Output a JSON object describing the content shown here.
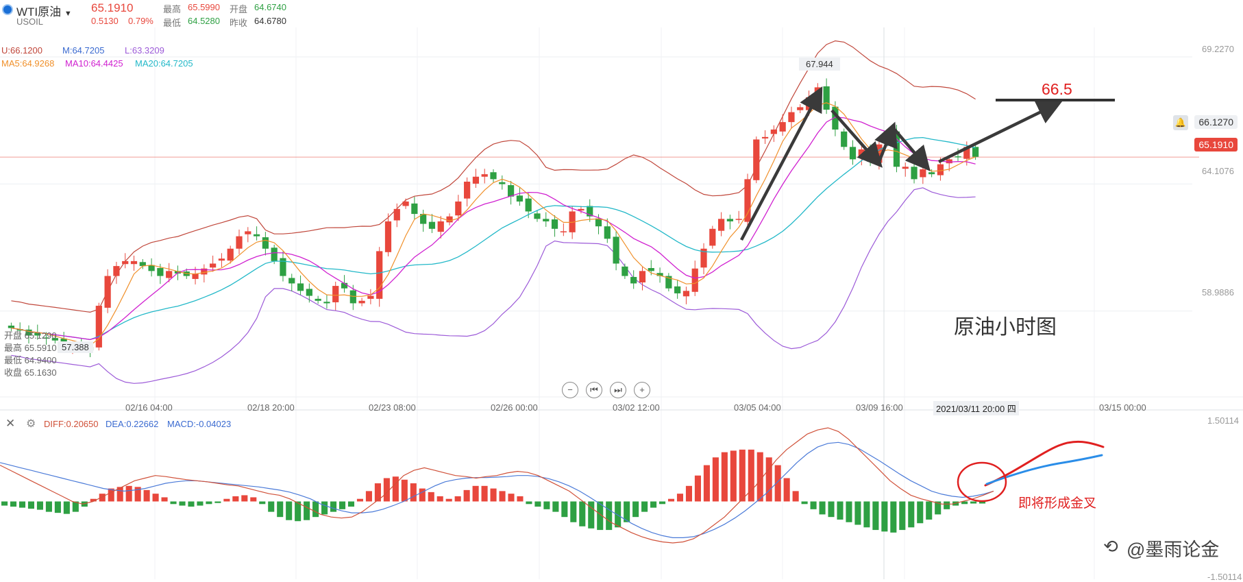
{
  "header": {
    "symbol_name": "WTI原油",
    "symbol_code": "USOIL",
    "price": "65.1910",
    "change": "0.5130",
    "change_pct": "0.79%",
    "high_label": "最高",
    "high": "65.5990",
    "open_label": "开盘",
    "open": "64.6740",
    "low_label": "最低",
    "low": "64.5280",
    "prev_close_label": "昨收",
    "prev_close": "64.6780"
  },
  "indicators": {
    "boll": {
      "u": "U:66.1200",
      "m": "M:64.7205",
      "l": "L:63.3209"
    },
    "ma": {
      "ma5": "MA5:64.9268",
      "ma10": "MA10:64.4425",
      "ma20": "MA20:64.7205"
    },
    "macd": {
      "diff": "DIFF:0.20650",
      "dea": "DEA:0.22662",
      "macd": "MACD:-0.04023"
    }
  },
  "ohlc_panel": {
    "open": "开盘 65.1290",
    "high": "最高 65.5910",
    "low": "最低 64.9400",
    "close": "收盘 65.1630"
  },
  "annotations": {
    "chart_title": "原油小时图",
    "target": "66.5",
    "peak": "67.944",
    "trough": "57.388",
    "golden_cross": "即将形成金叉",
    "watermark": "@墨雨论金",
    "cursor_time": "2021/03/11 20:00 四"
  },
  "price_axis": [
    "69.2270",
    "64.1076",
    "58.9886"
  ],
  "macd_axis": [
    "1.50114",
    "-1.50114"
  ],
  "price_tags": {
    "alert": "66.1270",
    "current": "65.1910"
  },
  "time_axis": [
    "02/16 04:00",
    "02/18 20:00",
    "02/23 08:00",
    "02/26 00:00",
    "03/02 12:00",
    "03/05 04:00",
    "03/09 16:00",
    "03/15 00:00"
  ],
  "colors": {
    "up": "#e8473c",
    "down": "#2ea043",
    "ma5": "#f0902a",
    "ma10": "#d020d0",
    "ma20": "#22b8c8",
    "boll_upper": "#c0463a",
    "boll_lower": "#9c5ad8",
    "diff": "#d05038",
    "dea": "#4a7ad8"
  },
  "chart_data": [
    {
      "type": "candlestick",
      "title": "",
      "y_ticks": [
        58.9886,
        64.1076,
        69.227
      ],
      "ylim": [
        55.5,
        70.0
      ],
      "x_ticks": [
        "02/16 04:00",
        "02/18 20:00",
        "02/23 08:00",
        "02/26 00:00",
        "03/02 12:00",
        "03/05 04:00",
        "03/09 16:00",
        "03/15 00:00"
      ],
      "closes": [
        58.3,
        58.2,
        58.0,
        58.0,
        57.9,
        57.8,
        57.7,
        57.6,
        57.5,
        57.4,
        59.2,
        60.4,
        60.8,
        61.0,
        61.0,
        60.8,
        60.6,
        60.4,
        60.6,
        60.5,
        60.4,
        60.5,
        60.7,
        60.9,
        61.1,
        61.5,
        62.0,
        62.2,
        62.0,
        61.5,
        61.0,
        60.4,
        60.1,
        59.8,
        59.6,
        59.4,
        59.3,
        60.0,
        59.9,
        59.3,
        59.4,
        59.6,
        61.4,
        62.6,
        63.1,
        63.4,
        62.9,
        62.5,
        62.3,
        62.6,
        62.8,
        63.4,
        64.2,
        64.4,
        64.5,
        64.3,
        64.1,
        63.6,
        63.4,
        63.0,
        62.7,
        62.6,
        62.3,
        62.2,
        63.0,
        63.1,
        62.8,
        62.4,
        61.9,
        60.9,
        60.4,
        60.1,
        60.6,
        60.6,
        60.4,
        59.9,
        59.7,
        59.8,
        60.7,
        61.5,
        62.3,
        62.7,
        62.6,
        62.7,
        64.3,
        65.9,
        66.0,
        66.3,
        66.6,
        67.0,
        67.2,
        67.6,
        68.0,
        67.1,
        66.3,
        65.6,
        65.1,
        65.5,
        65.0,
        65.7,
        66.1,
        64.8,
        64.8,
        64.3,
        64.7,
        64.5,
        64.9,
        65.1,
        65.2,
        65.6,
        65.2
      ],
      "open_labels": "plotted as OHLC bars; high and low approximate",
      "series": [
        {
          "name": "MA5"
        },
        {
          "name": "MA10"
        },
        {
          "name": "MA20"
        },
        {
          "name": "BOLL U"
        },
        {
          "name": "BOLL L"
        }
      ]
    },
    {
      "type": "bar",
      "title": "",
      "ylim": [
        -1.50114,
        1.50114
      ],
      "hist": [
        -0.08,
        -0.1,
        -0.12,
        -0.14,
        -0.16,
        -0.2,
        -0.22,
        -0.24,
        -0.2,
        -0.1,
        0.05,
        0.15,
        0.25,
        0.28,
        0.3,
        0.28,
        0.22,
        0.15,
        0.08,
        -0.05,
        -0.08,
        -0.1,
        -0.08,
        -0.05,
        -0.03,
        0.05,
        0.1,
        0.12,
        0.08,
        -0.05,
        -0.2,
        -0.3,
        -0.36,
        -0.38,
        -0.36,
        -0.3,
        -0.25,
        -0.2,
        -0.15,
        -0.1,
        0.05,
        0.2,
        0.35,
        0.45,
        0.48,
        0.42,
        0.35,
        0.25,
        0.18,
        0.1,
        0.05,
        0.1,
        0.22,
        0.3,
        0.3,
        0.25,
        0.2,
        0.15,
        0.1,
        -0.05,
        -0.1,
        -0.15,
        -0.2,
        -0.3,
        -0.4,
        -0.48,
        -0.52,
        -0.55,
        -0.55,
        -0.5,
        -0.4,
        -0.3,
        -0.2,
        -0.12,
        -0.05,
        0.05,
        0.15,
        0.3,
        0.5,
        0.7,
        0.85,
        0.95,
        0.98,
        1.0,
        1.0,
        0.95,
        0.85,
        0.7,
        0.45,
        0.2,
        -0.05,
        -0.15,
        -0.25,
        -0.3,
        -0.35,
        -0.4,
        -0.45,
        -0.5,
        -0.55,
        -0.58,
        -0.6,
        -0.55,
        -0.5,
        -0.42,
        -0.35,
        -0.25,
        -0.15,
        -0.08,
        -0.05,
        -0.04,
        -0.04
      ],
      "diff": [
        0.7,
        0.6,
        0.5,
        0.4,
        0.3,
        0.2,
        0.1,
        0.0,
        -0.05,
        0.0,
        0.1,
        0.2,
        0.3,
        0.4,
        0.45,
        0.5,
        0.48,
        0.45,
        0.42,
        0.4,
        0.38,
        0.35,
        0.32,
        0.3,
        0.25,
        0.2,
        0.15,
        0.12,
        0.05,
        -0.05,
        -0.15,
        -0.25,
        -0.3,
        -0.32,
        -0.3,
        -0.2,
        -0.05,
        0.1,
        0.3,
        0.5,
        0.6,
        0.65,
        0.6,
        0.55,
        0.5,
        0.48,
        0.45,
        0.48,
        0.5,
        0.55,
        0.58,
        0.56,
        0.5,
        0.4,
        0.3,
        0.2,
        0.05,
        -0.1,
        -0.25,
        -0.4,
        -0.5,
        -0.6,
        -0.68,
        -0.74,
        -0.78,
        -0.8,
        -0.78,
        -0.72,
        -0.6,
        -0.45,
        -0.3,
        -0.1,
        0.1,
        0.3,
        0.55,
        0.8,
        1.0,
        1.15,
        1.3,
        1.38,
        1.42,
        1.35,
        1.2,
        1.0,
        0.8,
        0.6,
        0.4,
        0.25,
        0.12,
        0.05,
        0.0,
        -0.05,
        -0.05,
        0.0,
        0.05,
        0.12,
        0.2
      ],
      "dea": [
        0.75,
        0.7,
        0.65,
        0.6,
        0.55,
        0.5,
        0.45,
        0.4,
        0.35,
        0.3,
        0.25,
        0.22,
        0.2,
        0.22,
        0.25,
        0.3,
        0.35,
        0.38,
        0.4,
        0.4,
        0.38,
        0.36,
        0.34,
        0.32,
        0.3,
        0.28,
        0.25,
        0.22,
        0.18,
        0.12,
        0.05,
        -0.05,
        -0.12,
        -0.18,
        -0.22,
        -0.22,
        -0.2,
        -0.15,
        -0.08,
        0.0,
        0.1,
        0.2,
        0.3,
        0.38,
        0.42,
        0.45,
        0.46,
        0.46,
        0.47,
        0.48,
        0.5,
        0.5,
        0.48,
        0.44,
        0.38,
        0.3,
        0.2,
        0.08,
        -0.05,
        -0.18,
        -0.3,
        -0.42,
        -0.52,
        -0.6,
        -0.66,
        -0.7,
        -0.7,
        -0.68,
        -0.62,
        -0.54,
        -0.44,
        -0.32,
        -0.18,
        -0.02,
        0.15,
        0.35,
        0.55,
        0.75,
        0.92,
        1.05,
        1.12,
        1.14,
        1.1,
        1.02,
        0.9,
        0.78,
        0.65,
        0.52,
        0.4,
        0.3,
        0.2,
        0.14,
        0.1,
        0.08,
        0.1,
        0.14,
        0.2
      ]
    }
  ]
}
